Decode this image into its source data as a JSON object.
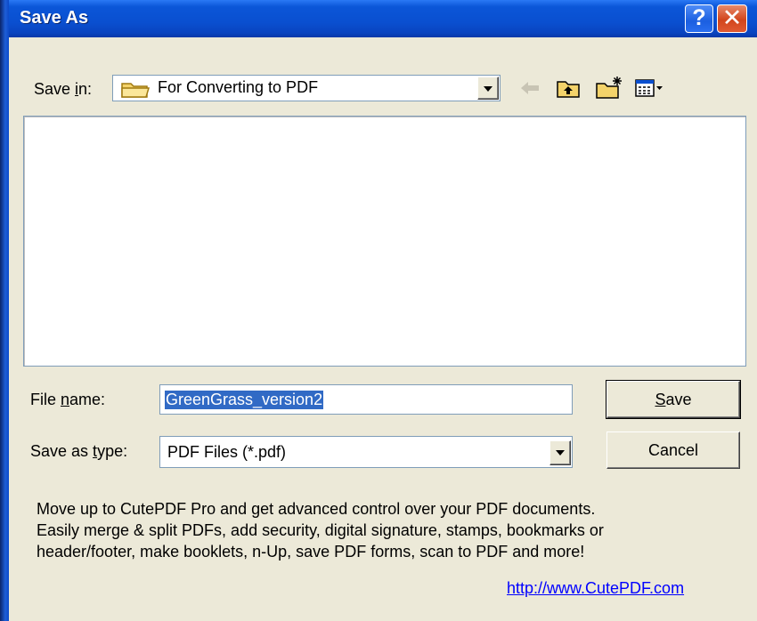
{
  "window": {
    "title": "Save As",
    "help_label": "?",
    "close_label": "✕"
  },
  "save_in": {
    "label_pre": "Save ",
    "label_accel": "i",
    "label_post": "n:",
    "value": "For Converting to PDF"
  },
  "toolbar": {
    "icons": [
      "back-arrow-icon",
      "up-folder-icon",
      "new-folder-icon",
      "view-menu-icon"
    ]
  },
  "file_name": {
    "label_pre": "File ",
    "label_accel": "n",
    "label_post": "ame:",
    "value": "GreenGrass_version2"
  },
  "save_as_type": {
    "label_pre": "Save as ",
    "label_accel": "t",
    "label_post": "ype:",
    "value": "PDF Files (*.pdf)"
  },
  "buttons": {
    "save_accel": "S",
    "save_rest": "ave",
    "cancel": "Cancel"
  },
  "promo": {
    "lines": [
      "Move up to CutePDF Pro and get advanced control over your PDF documents.",
      "Easily merge & split PDFs, add security, digital signature, stamps, bookmarks or",
      "header/footer, make booklets, n-Up, save PDF forms, scan to PDF and more!"
    ],
    "link": "http://www.CutePDF.com"
  },
  "colors": {
    "titlebar": "#0a4fd0",
    "dialog_bg": "#ece9d8",
    "selection": "#316ac5",
    "link": "#0000ff"
  }
}
